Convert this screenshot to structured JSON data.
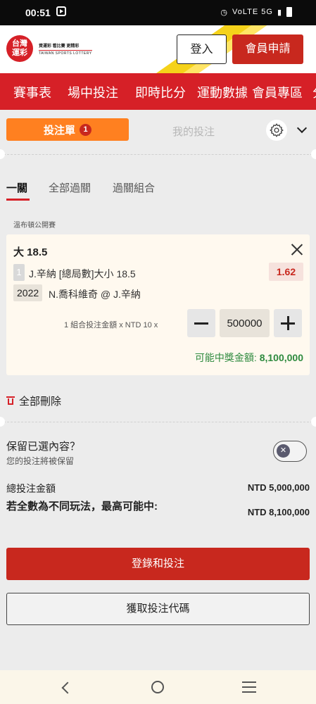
{
  "status_bar": {
    "time": "00:51",
    "indicators": "VoLTE 5G"
  },
  "header": {
    "logo_mark": "台灣運彩",
    "logo_text_cn": "資運彩 看比賽 更精彩",
    "logo_text_en": "TAIWAN SPORTS LOTTERY",
    "login_label": "登入",
    "register_label": "會員申請"
  },
  "nav": {
    "items": [
      "賽事表",
      "場中投注",
      "即時比分",
      "運動數據",
      "會員專區",
      "分"
    ]
  },
  "betslip": {
    "tab_slip_label": "投注單",
    "tab_slip_count": "1",
    "tab_mybets_label": "我的投注",
    "bet_types": [
      "一關",
      "全部過關",
      "過關組合"
    ]
  },
  "bet": {
    "event_name": "溫布頓公開賽",
    "selection": "大 18.5",
    "mark_number": "1",
    "market": "J.辛納 [總局數]大小 18.5",
    "odds": "1.62",
    "match_code": "2022",
    "match": "N.喬科維奇 @ J.辛納",
    "stake_label": "1 組合投注金額 x NTD 10 x",
    "stake_value": "500000",
    "win_label": "可能中獎金額: ",
    "win_value": "8,100,000"
  },
  "actions": {
    "delete_all_label": "全部刪除",
    "keep_title": "保留已選內容？",
    "keep_sub": "您的投注將被保留",
    "keep_enabled": false,
    "total_label": "總投注金額",
    "total_value": "NTD 5,000,000",
    "max_label": "若全數為不同玩法，最高可能中:",
    "max_value": "NTD 8,100,000",
    "place_bet_label": "登錄和投注",
    "get_code_label": "獲取投注代碼"
  },
  "colors": {
    "brand_red": "#d62027",
    "accent_orange": "#ff8020",
    "win_green": "#2d8a3e",
    "stripe_yellow": "#f5d21a"
  }
}
